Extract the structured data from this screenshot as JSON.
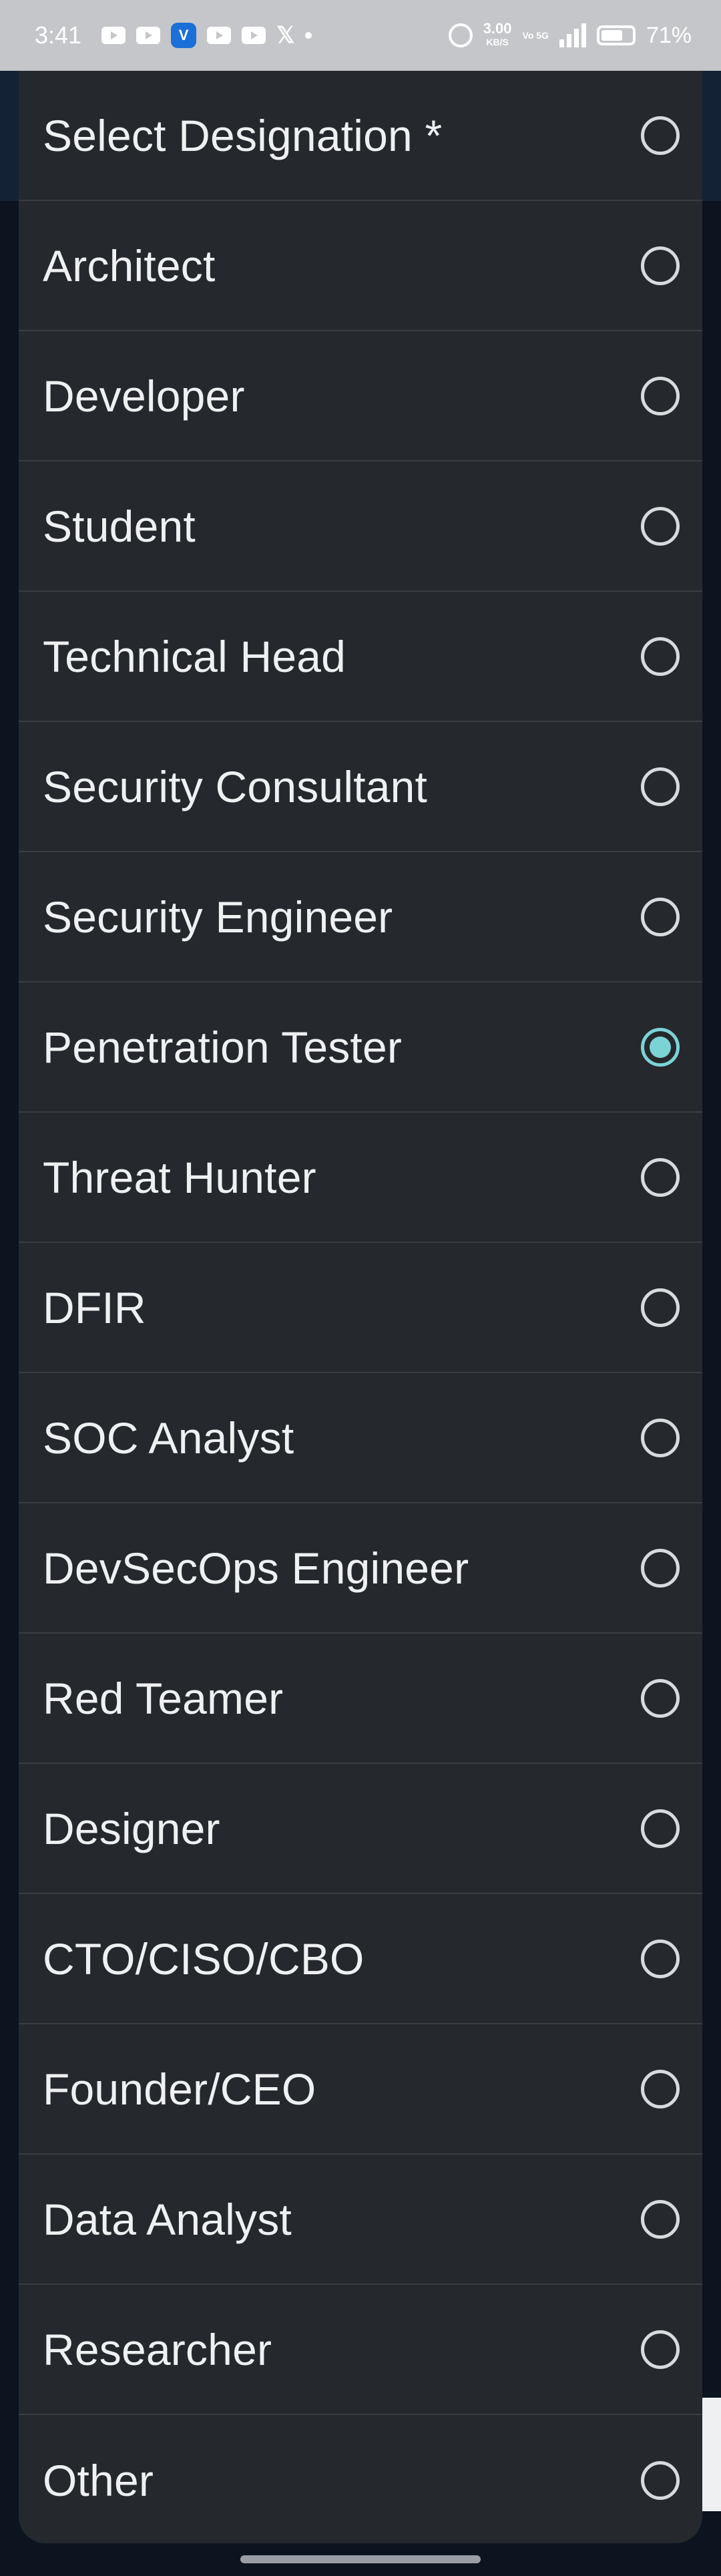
{
  "status_bar": {
    "time": "3:41",
    "network_speed": "3.00",
    "network_speed_unit": "KB/S",
    "volte": "Vo 5G",
    "battery_percent": "71%",
    "battery_level": 0.71,
    "notification_icons": [
      "youtube-icon",
      "youtube-icon",
      "app-icon",
      "youtube-icon",
      "youtube-icon",
      "x-icon",
      "dot-icon"
    ]
  },
  "dialog": {
    "title": "Select Designation *",
    "selected_index": 7,
    "options": [
      {
        "label": "Architect",
        "checked": false
      },
      {
        "label": "Developer",
        "checked": false
      },
      {
        "label": "Student",
        "checked": false
      },
      {
        "label": "Technical Head",
        "checked": false
      },
      {
        "label": "Security Consultant",
        "checked": false
      },
      {
        "label": "Security Engineer",
        "checked": false
      },
      {
        "label": "Penetration Tester",
        "checked": true
      },
      {
        "label": "Threat Hunter",
        "checked": false
      },
      {
        "label": "DFIR",
        "checked": false
      },
      {
        "label": "SOC Analyst",
        "checked": false
      },
      {
        "label": "DevSecOps Engineer",
        "checked": false
      },
      {
        "label": "Red Teamer",
        "checked": false
      },
      {
        "label": "Designer",
        "checked": false
      },
      {
        "label": "CTO/CISO/CBO",
        "checked": false
      },
      {
        "label": "Founder/CEO",
        "checked": false
      },
      {
        "label": "Data Analyst",
        "checked": false
      },
      {
        "label": "Researcher",
        "checked": false
      },
      {
        "label": "Other",
        "checked": false
      }
    ]
  },
  "colors": {
    "dialog_bg": "#25282c",
    "accent": "#7cd3d6",
    "text": "#eef0f2"
  }
}
